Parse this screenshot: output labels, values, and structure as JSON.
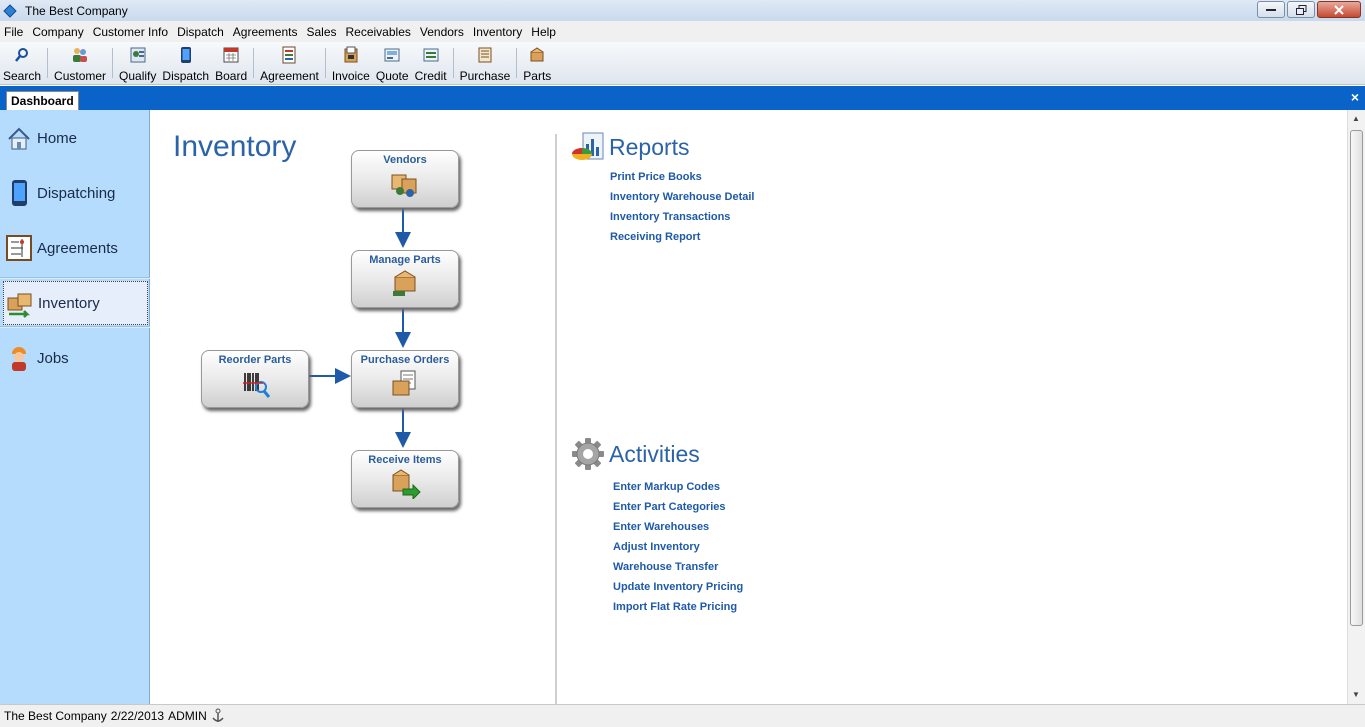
{
  "window": {
    "title": "The Best Company"
  },
  "menu": [
    "File",
    "Company",
    "Customer Info",
    "Dispatch",
    "Agreements",
    "Sales",
    "Receivables",
    "Vendors",
    "Inventory",
    "Help"
  ],
  "toolbar": {
    "search": "Search",
    "customer": "Customer",
    "qualify": "Qualify",
    "dispatch": "Dispatch",
    "board": "Board",
    "agreement": "Agreement",
    "invoice": "Invoice",
    "quote": "Quote",
    "credit": "Credit",
    "purchase": "Purchase",
    "parts": "Parts"
  },
  "tabs": {
    "dashboard": "Dashboard",
    "close": "×"
  },
  "sidebar": {
    "items": [
      {
        "label": "Home"
      },
      {
        "label": "Dispatching"
      },
      {
        "label": "Agreements"
      },
      {
        "label": "Inventory"
      },
      {
        "label": "Jobs"
      }
    ]
  },
  "main": {
    "title": "Inventory",
    "flow": {
      "vendors": "Vendors",
      "manage_parts": "Manage Parts",
      "reorder_parts": "Reorder Parts",
      "purchase_orders": "Purchase Orders",
      "receive_items": "Receive Items"
    },
    "reports": {
      "title": "Reports",
      "links": [
        "Print Price Books",
        "Inventory Warehouse Detail",
        "Inventory Transactions",
        "Receiving Report"
      ]
    },
    "activities": {
      "title": "Activities",
      "links": [
        "Enter Markup Codes",
        "Enter Part Categories",
        "Enter Warehouses",
        "Adjust Inventory",
        "Warehouse Transfer",
        "Update Inventory Pricing",
        "Import Flat Rate Pricing"
      ]
    }
  },
  "status": {
    "company": "The Best Company",
    "date": "2/22/2013",
    "user": "ADMIN"
  },
  "colors": {
    "accent": "#0a63c9",
    "sidebar": "#b5dcfc",
    "heading": "#2b63a8",
    "link": "#1e5aa8"
  }
}
